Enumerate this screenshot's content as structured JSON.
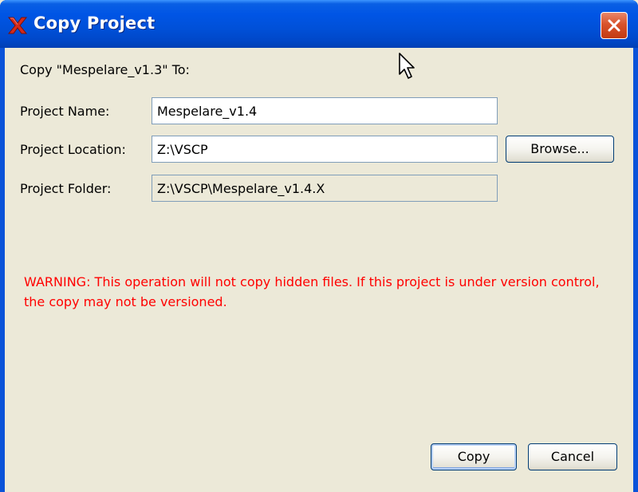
{
  "window": {
    "title": "Copy Project",
    "app_icon": "x-logo-icon",
    "close_icon": "close-icon"
  },
  "dialog": {
    "heading": "Copy \"Mespelare_v1.3\" To:",
    "project_name_label": "Project Name:",
    "project_name_value": "Mespelare_v1.4",
    "project_location_label": "Project Location:",
    "project_location_value": "Z:\\VSCP",
    "browse_label": "Browse...",
    "project_folder_label": "Project Folder:",
    "project_folder_value": "Z:\\VSCP\\Mespelare_v1.4.X",
    "warning": "WARNING: This operation will not copy hidden files. If this project is under version control, the copy may not be versioned.",
    "copy_label": "Copy",
    "cancel_label": "Cancel"
  },
  "colors": {
    "titlebar": "#0055e5",
    "window_bg": "#ece9d8",
    "warning_text": "#ff0000",
    "close_button": "#d9532c"
  }
}
